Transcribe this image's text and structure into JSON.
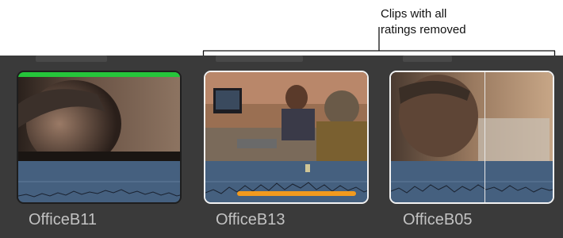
{
  "callout": {
    "line1": "Clips with all",
    "line2": "ratings removed"
  },
  "clips": [
    {
      "name": "OfficeB11",
      "rating": "favorite",
      "selected": false
    },
    {
      "name": "OfficeB13",
      "rating": "none",
      "selected": true
    },
    {
      "name": "OfficeB05",
      "rating": "none",
      "selected": true
    }
  ],
  "colors": {
    "favorite_bar": "#25c53a",
    "keyword_bar": "#f29a1e",
    "waveform_bg": "#45607f",
    "browser_bg": "#3a3a3a"
  }
}
